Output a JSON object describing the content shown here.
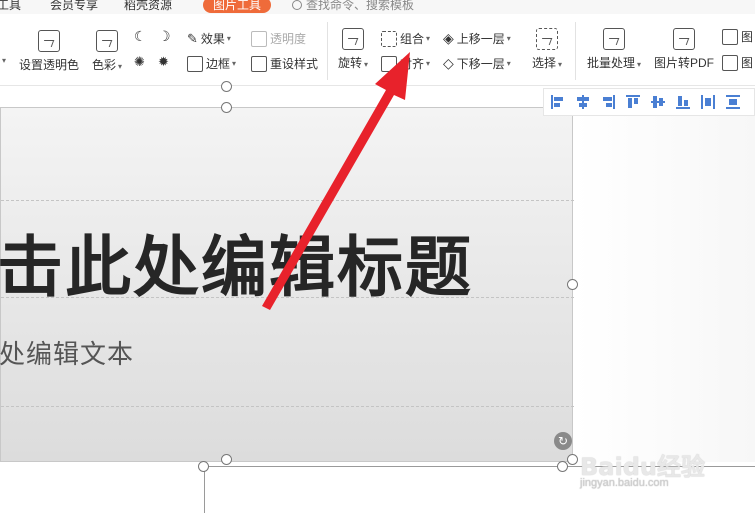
{
  "tabs": {
    "items": [
      {
        "label": "工具",
        "active": false
      },
      {
        "label": "会员专享",
        "active": false
      },
      {
        "label": "稻壳资源",
        "active": false
      },
      {
        "label": "图片工具",
        "active": true
      }
    ],
    "search_label": "查找命令、搜索模板"
  },
  "ribbon": {
    "set_transparent_color": "设置透明色",
    "color_label": "色彩",
    "effects_label": "效果",
    "transparency_label": "透明度",
    "border_label": "边框",
    "reset_style_label": "重设样式",
    "rotate_label": "旋转",
    "group_label": "组合",
    "align_label": "对齐",
    "bring_forward_label": "上移一层",
    "send_backward_label": "下移一层",
    "select_label": "选择",
    "batch_process_label": "批量处理",
    "image_to_pdf_label": "图片转PDF",
    "image_cut_1": "图",
    "image_cut_2": "图"
  },
  "align_toolbar": {
    "icons": [
      "align-left-icon",
      "align-center-icon",
      "align-right-icon",
      "align-top-icon",
      "align-middle-icon",
      "align-bottom-icon",
      "distribute-horizontal-icon",
      "distribute-vertical-icon"
    ]
  },
  "slide": {
    "title": "击此处编辑标题",
    "subtitle": "处编辑文本"
  },
  "annotation": {
    "arrow_color": "#e8222b"
  },
  "watermark": {
    "brand": "Baidu经验",
    "url": "jingyan.baidu.com"
  },
  "colors": {
    "accent_tab": "#ef6b3a",
    "align_icon": "#4a7fd3"
  }
}
